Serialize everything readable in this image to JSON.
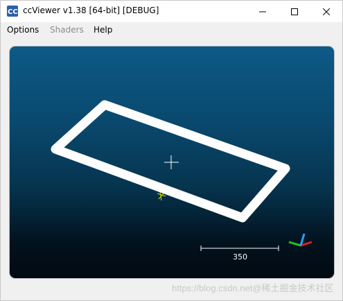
{
  "window": {
    "title": "ccViewer v1.38 [64-bit] [DEBUG]",
    "icon": "cc-app-icon"
  },
  "title_buttons": {
    "minimize": "minimize-icon",
    "maximize": "maximize-icon",
    "close": "close-icon"
  },
  "menu": {
    "items": [
      {
        "label": "Options",
        "enabled": true
      },
      {
        "label": "Shaders",
        "enabled": false
      },
      {
        "label": "Help",
        "enabled": true
      }
    ]
  },
  "viewport": {
    "scale_value": "350",
    "background_top": "#0d5a87",
    "background_bottom": "#010a12",
    "point_cloud_color": "#ffffff",
    "axis_colors": {
      "x": "#e02020",
      "y": "#20c020",
      "z": "#2aa0ff"
    },
    "pivot_color": "#d8d800"
  },
  "watermark": "https://blog.csdn.net@稀土掘金技术社区"
}
